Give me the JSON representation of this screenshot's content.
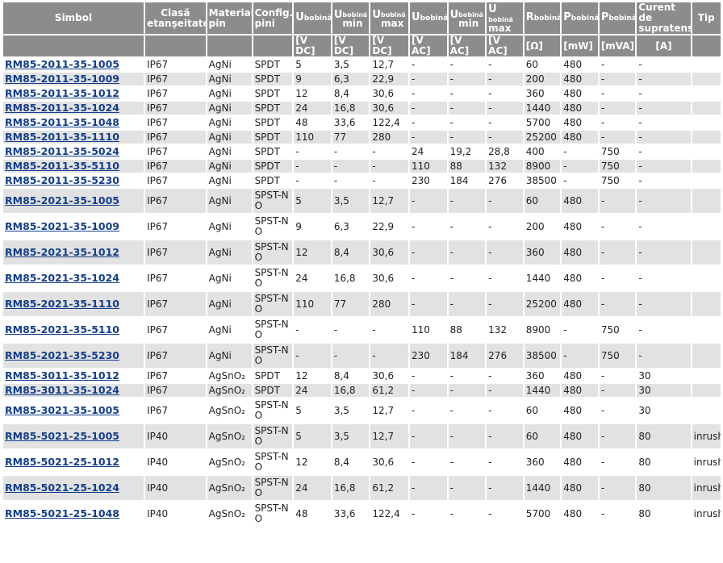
{
  "header": {
    "simbol": "Simbol",
    "clasa_l1": "Clasă",
    "clasa_l2": "etanşeitate",
    "material_l1": "Material",
    "material_l2": "pin",
    "config_l1": "Config.",
    "config_l2": "pini",
    "u_letter": "U",
    "p_letter": "P",
    "r_letter": "R",
    "bobina": "bobină",
    "min": "min",
    "max": "max",
    "curent_l1": "Curent de",
    "curent_l2": "supratens.",
    "tip": "Tip",
    "units": [
      "[V DC]",
      "[V DC]",
      "[V DC]",
      "[V AC]",
      "[V AC]",
      "[V AC]",
      "[Ω]",
      "[mW]",
      "[mVA]",
      "[A]"
    ]
  },
  "rows": [
    {
      "symbol": "RM85-2011-35-1005",
      "ip": "IP67",
      "mat": "AgNi",
      "cfg": "SPDT",
      "udc": "5",
      "udcmin": "3,5",
      "udcmax": "12,7",
      "uac": "-",
      "uacmin": "-",
      "uacmax": "-",
      "r": "60",
      "pmw": "480",
      "pmva": "-",
      "cur": "-",
      "tip": ""
    },
    {
      "symbol": "RM85-2011-35-1009",
      "ip": "IP67",
      "mat": "AgNi",
      "cfg": "SPDT",
      "udc": "9",
      "udcmin": "6,3",
      "udcmax": "22,9",
      "uac": "-",
      "uacmin": "-",
      "uacmax": "-",
      "r": "200",
      "pmw": "480",
      "pmva": "-",
      "cur": "-",
      "tip": ""
    },
    {
      "symbol": "RM85-2011-35-1012",
      "ip": "IP67",
      "mat": "AgNi",
      "cfg": "SPDT",
      "udc": "12",
      "udcmin": "8,4",
      "udcmax": "30,6",
      "uac": "-",
      "uacmin": "-",
      "uacmax": "-",
      "r": "360",
      "pmw": "480",
      "pmva": "-",
      "cur": "-",
      "tip": ""
    },
    {
      "symbol": "RM85-2011-35-1024",
      "ip": "IP67",
      "mat": "AgNi",
      "cfg": "SPDT",
      "udc": "24",
      "udcmin": "16,8",
      "udcmax": "30,6",
      "uac": "-",
      "uacmin": "-",
      "uacmax": "-",
      "r": "1440",
      "pmw": "480",
      "pmva": "-",
      "cur": "-",
      "tip": ""
    },
    {
      "symbol": "RM85-2011-35-1048",
      "ip": "IP67",
      "mat": "AgNi",
      "cfg": "SPDT",
      "udc": "48",
      "udcmin": "33,6",
      "udcmax": "122,4",
      "uac": "-",
      "uacmin": "-",
      "uacmax": "-",
      "r": "5700",
      "pmw": "480",
      "pmva": "-",
      "cur": "-",
      "tip": ""
    },
    {
      "symbol": "RM85-2011-35-1110",
      "ip": "IP67",
      "mat": "AgNi",
      "cfg": "SPDT",
      "udc": "110",
      "udcmin": "77",
      "udcmax": "280",
      "uac": "-",
      "uacmin": "-",
      "uacmax": "-",
      "r": "25200",
      "pmw": "480",
      "pmva": "-",
      "cur": "-",
      "tip": ""
    },
    {
      "symbol": "RM85-2011-35-5024",
      "ip": "IP67",
      "mat": "AgNi",
      "cfg": "SPDT",
      "udc": "-",
      "udcmin": "-",
      "udcmax": "-",
      "uac": "24",
      "uacmin": "19,2",
      "uacmax": "28,8",
      "r": "400",
      "pmw": "-",
      "pmva": "750",
      "cur": "-",
      "tip": ""
    },
    {
      "symbol": "RM85-2011-35-5110",
      "ip": "IP67",
      "mat": "AgNi",
      "cfg": "SPDT",
      "udc": "-",
      "udcmin": "-",
      "udcmax": "-",
      "uac": "110",
      "uacmin": "88",
      "uacmax": "132",
      "r": "8900",
      "pmw": "-",
      "pmva": "750",
      "cur": "-",
      "tip": ""
    },
    {
      "symbol": "RM85-2011-35-5230",
      "ip": "IP67",
      "mat": "AgNi",
      "cfg": "SPDT",
      "udc": "-",
      "udcmin": "-",
      "udcmax": "-",
      "uac": "230",
      "uacmin": "184",
      "uacmax": "276",
      "r": "38500",
      "pmw": "-",
      "pmva": "750",
      "cur": "-",
      "tip": ""
    },
    {
      "symbol": "RM85-2021-35-1005",
      "ip": "IP67",
      "mat": "AgNi",
      "cfg": "SPST-NO",
      "udc": "5",
      "udcmin": "3,5",
      "udcmax": "12,7",
      "uac": "-",
      "uacmin": "-",
      "uacmax": "-",
      "r": "60",
      "pmw": "480",
      "pmva": "-",
      "cur": "-",
      "tip": ""
    },
    {
      "symbol": "RM85-2021-35-1009",
      "ip": "IP67",
      "mat": "AgNi",
      "cfg": "SPST-NO",
      "udc": "9",
      "udcmin": "6,3",
      "udcmax": "22,9",
      "uac": "-",
      "uacmin": "-",
      "uacmax": "-",
      "r": "200",
      "pmw": "480",
      "pmva": "-",
      "cur": "-",
      "tip": ""
    },
    {
      "symbol": "RM85-2021-35-1012",
      "ip": "IP67",
      "mat": "AgNi",
      "cfg": "SPST-NO",
      "udc": "12",
      "udcmin": "8,4",
      "udcmax": "30,6",
      "uac": "-",
      "uacmin": "-",
      "uacmax": "-",
      "r": "360",
      "pmw": "480",
      "pmva": "-",
      "cur": "-",
      "tip": ""
    },
    {
      "symbol": "RM85-2021-35-1024",
      "ip": "IP67",
      "mat": "AgNi",
      "cfg": "SPST-NO",
      "udc": "24",
      "udcmin": "16,8",
      "udcmax": "30,6",
      "uac": "-",
      "uacmin": "-",
      "uacmax": "-",
      "r": "1440",
      "pmw": "480",
      "pmva": "-",
      "cur": "-",
      "tip": ""
    },
    {
      "symbol": "RM85-2021-35-1110",
      "ip": "IP67",
      "mat": "AgNi",
      "cfg": "SPST-NO",
      "udc": "110",
      "udcmin": "77",
      "udcmax": "280",
      "uac": "-",
      "uacmin": "-",
      "uacmax": "-",
      "r": "25200",
      "pmw": "480",
      "pmva": "-",
      "cur": "-",
      "tip": ""
    },
    {
      "symbol": "RM85-2021-35-5110",
      "ip": "IP67",
      "mat": "AgNi",
      "cfg": "SPST-NO",
      "udc": "-",
      "udcmin": "-",
      "udcmax": "-",
      "uac": "110",
      "uacmin": "88",
      "uacmax": "132",
      "r": "8900",
      "pmw": "-",
      "pmva": "750",
      "cur": "-",
      "tip": ""
    },
    {
      "symbol": "RM85-2021-35-5230",
      "ip": "IP67",
      "mat": "AgNi",
      "cfg": "SPST-NO",
      "udc": "-",
      "udcmin": "-",
      "udcmax": "-",
      "uac": "230",
      "uacmin": "184",
      "uacmax": "276",
      "r": "38500",
      "pmw": "-",
      "pmva": "750",
      "cur": "-",
      "tip": ""
    },
    {
      "symbol": "RM85-3011-35-1012",
      "ip": "IP67",
      "mat": "AgSnO₂",
      "cfg": "SPDT",
      "udc": "12",
      "udcmin": "8,4",
      "udcmax": "30,6",
      "uac": "-",
      "uacmin": "-",
      "uacmax": "-",
      "r": "360",
      "pmw": "480",
      "pmva": "-",
      "cur": "30",
      "tip": ""
    },
    {
      "symbol": "RM85-3011-35-1024",
      "ip": "IP67",
      "mat": "AgSnO₂",
      "cfg": "SPDT",
      "udc": "24",
      "udcmin": "16,8",
      "udcmax": "61,2",
      "uac": "-",
      "uacmin": "-",
      "uacmax": "-",
      "r": "1440",
      "pmw": "480",
      "pmva": "-",
      "cur": "30",
      "tip": ""
    },
    {
      "symbol": "RM85-3021-35-1005",
      "ip": "IP67",
      "mat": "AgSnO₂",
      "cfg": "SPST-NO",
      "udc": "5",
      "udcmin": "3,5",
      "udcmax": "12,7",
      "uac": "-",
      "uacmin": "-",
      "uacmax": "-",
      "r": "60",
      "pmw": "480",
      "pmva": "-",
      "cur": "30",
      "tip": ""
    },
    {
      "symbol": "RM85-5021-25-1005",
      "ip": "IP40",
      "mat": "AgSnO₂",
      "cfg": "SPST-NO",
      "udc": "5",
      "udcmin": "3,5",
      "udcmax": "12,7",
      "uac": "-",
      "uacmin": "-",
      "uacmax": "-",
      "r": "60",
      "pmw": "480",
      "pmva": "-",
      "cur": "80",
      "tip": "inrush"
    },
    {
      "symbol": "RM85-5021-25-1012",
      "ip": "IP40",
      "mat": "AgSnO₂",
      "cfg": "SPST-NO",
      "udc": "12",
      "udcmin": "8,4",
      "udcmax": "30,6",
      "uac": "-",
      "uacmin": "-",
      "uacmax": "-",
      "r": "360",
      "pmw": "480",
      "pmva": "-",
      "cur": "80",
      "tip": "inrush"
    },
    {
      "symbol": "RM85-5021-25-1024",
      "ip": "IP40",
      "mat": "AgSnO₂",
      "cfg": "SPST-NO",
      "udc": "24",
      "udcmin": "16,8",
      "udcmax": "61,2",
      "uac": "-",
      "uacmin": "-",
      "uacmax": "-",
      "r": "1440",
      "pmw": "480",
      "pmva": "-",
      "cur": "80",
      "tip": "inrush"
    },
    {
      "symbol": "RM85-5021-25-1048",
      "ip": "IP40",
      "mat": "AgSnO₂",
      "cfg": "SPST-NO",
      "udc": "48",
      "udcmin": "33,6",
      "udcmax": "122,4",
      "uac": "-",
      "uacmin": "-",
      "uacmax": "-",
      "r": "5700",
      "pmw": "480",
      "pmva": "-",
      "cur": "80",
      "tip": "inrush"
    }
  ]
}
